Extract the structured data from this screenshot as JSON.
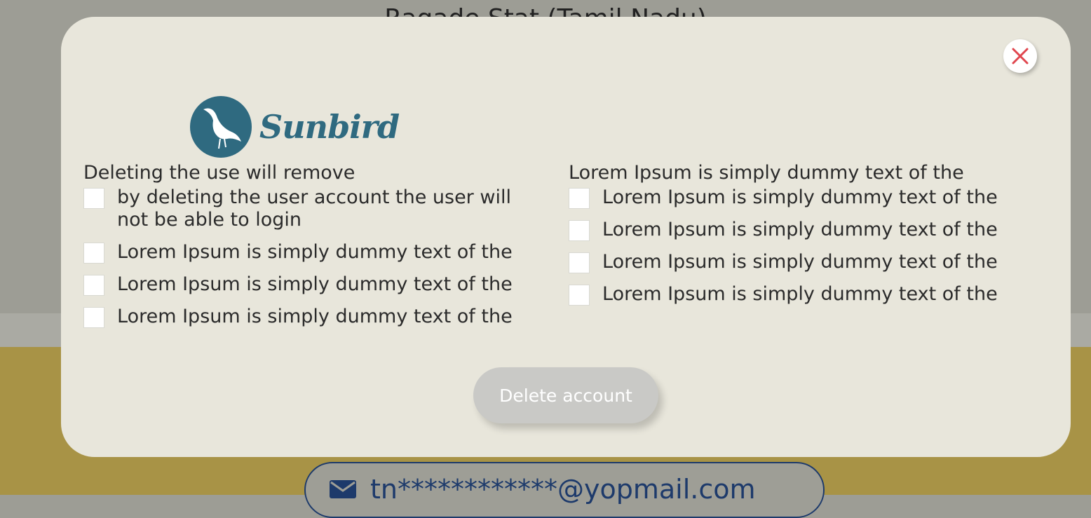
{
  "background": {
    "title": "Ragade Stat (Tamil Nadu)",
    "email": "tn************@yopmail.com",
    "email_icon": "envelope-icon"
  },
  "modal": {
    "close_icon": "close-icon",
    "logo_text": "Sunbird",
    "left_column": {
      "heading": "Deleting the use will remove",
      "options": [
        "by deleting the user account the user will not be able to login",
        "Lorem Ipsum is simply dummy text of the",
        "Lorem Ipsum is simply dummy text of the",
        "Lorem Ipsum is simply dummy text of the"
      ]
    },
    "right_column": {
      "heading": "Lorem Ipsum is simply dummy text of the",
      "options": [
        "Lorem Ipsum is simply dummy text of the",
        "Lorem Ipsum is simply dummy text of the",
        "Lorem Ipsum is simply dummy text of the",
        "Lorem Ipsum is simply dummy text of the"
      ]
    },
    "delete_button_label": "Delete account"
  },
  "colors": {
    "modal_bg": "#e8e6db",
    "brand": "#2f6a80",
    "close_x": "#e0464e",
    "delete_disabled": "#c9c9c6",
    "email_blue": "#1d3a6b",
    "page_gold": "#a89346"
  }
}
